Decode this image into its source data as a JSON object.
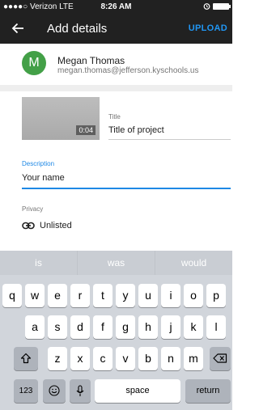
{
  "status_bar": {
    "carrier": "●●●●○ Verizon  LTE",
    "time": "8:26 AM",
    "icons": [
      "alarm-icon",
      "battery-icon"
    ]
  },
  "app_bar": {
    "title": "Add details",
    "back_icon": "arrow-left-icon",
    "action_label": "UPLOAD",
    "accent": "#2196F3"
  },
  "account": {
    "initial": "M",
    "name": "Megan Thomas",
    "email": "megan.thomas@jefferson.kyschools.us",
    "avatar_color": "#43a047"
  },
  "video": {
    "duration": "0:04"
  },
  "form": {
    "title_label": "Title",
    "title_value": "Title of project",
    "description_label": "Description",
    "description_value": "Your name",
    "privacy_label": "Privacy",
    "privacy_icon": "link-icon",
    "privacy_value": "Unlisted",
    "focus_color": "#1e88e5"
  },
  "keyboard": {
    "suggestions": [
      "is",
      "was",
      "would"
    ],
    "row1": [
      "q",
      "w",
      "e",
      "r",
      "t",
      "y",
      "u",
      "i",
      "o",
      "p"
    ],
    "row2": [
      "a",
      "s",
      "d",
      "f",
      "g",
      "h",
      "j",
      "k",
      "l"
    ],
    "row3": [
      "z",
      "x",
      "c",
      "v",
      "b",
      "n",
      "m"
    ],
    "shift_icon": "shift-icon",
    "delete_icon": "backspace-icon",
    "numbers_label": "123",
    "emoji_icon": "emoji-icon",
    "mic_icon": "microphone-icon",
    "space_label": "space",
    "return_label": "return"
  }
}
